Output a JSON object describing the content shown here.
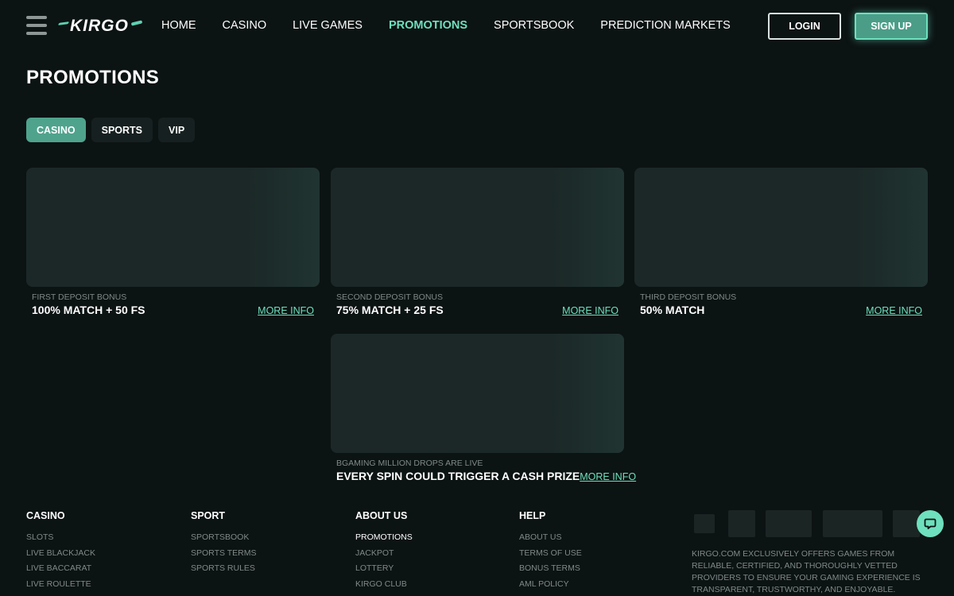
{
  "header": {
    "logo_text": "KIRGO",
    "nav": [
      "HOME",
      "CASINO",
      "LIVE GAMES",
      "PROMOTIONS",
      "SPORTSBOOK",
      "PREDICTION MARKETS"
    ],
    "active_nav": "PROMOTIONS",
    "login_label": "LOGIN",
    "signup_label": "SIGN UP"
  },
  "page": {
    "title": "PROMOTIONS",
    "tabs": [
      "CASINO",
      "SPORTS",
      "VIP"
    ],
    "active_tab": "CASINO"
  },
  "promotions": [
    {
      "subtitle": "FIRST DEPOSIT BONUS",
      "title": "100% MATCH + 50 FS",
      "link": "MORE INFO"
    },
    {
      "subtitle": "SECOND DEPOSIT BONUS",
      "title": "75% MATCH + 25 FS",
      "link": "MORE INFO"
    },
    {
      "subtitle": "THIRD DEPOSIT BONUS",
      "title": "50% MATCH",
      "link": "MORE INFO"
    },
    {
      "subtitle": "BGAMING MILLION DROPS ARE LIVE",
      "title": "EVERY SPIN COULD TRIGGER A CASH PRIZE",
      "link": "MORE INFO"
    }
  ],
  "footer": {
    "columns": [
      {
        "heading": "CASINO",
        "links": [
          "SLOTS",
          "LIVE BLACKJACK",
          "LIVE BACCARAT",
          "LIVE ROULETTE"
        ]
      },
      {
        "heading": "SPORT",
        "links": [
          "SPORTSBOOK",
          "SPORTS TERMS",
          "SPORTS RULES"
        ]
      },
      {
        "heading": "ABOUT US",
        "links": [
          "PROMOTIONS",
          "JACKPOT",
          "LOTTERY",
          "KIRGO CLUB"
        ]
      },
      {
        "heading": "HELP",
        "links": [
          "ABOUT US",
          "TERMS OF USE",
          "BONUS TERMS",
          "AML POLICY"
        ]
      }
    ],
    "disclaimer": "KIRGO.COM EXCLUSIVELY OFFERS GAMES FROM RELIABLE, CERTIFIED, AND THOROUGHLY VETTED PROVIDERS TO ENSURE YOUR GAMING EXPERIENCE IS TRANSPARENT, TRUSTWORTHY, AND ENJOYABLE."
  },
  "colors": {
    "background": "#0c1313",
    "accent": "#6ee0bd",
    "card": "#1b2827",
    "muted_text": "#7f8a88"
  },
  "icons": {
    "menu": "hamburger-menu-icon",
    "chat": "chat-bubble-icon"
  }
}
